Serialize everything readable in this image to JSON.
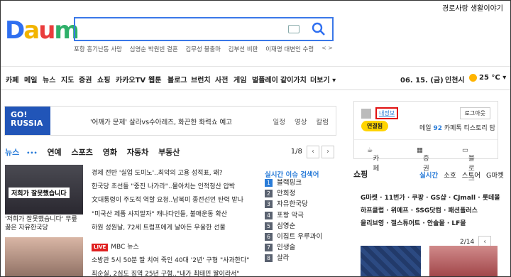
{
  "header": {
    "logo_text": "Daum",
    "stamp_text": "경로사랑 생활이야기",
    "trending": [
      "포항 흥기난동 사망",
      "심영순 박원빈 결혼",
      "김무성 불출마",
      "김부선 비판",
      "이재명 대변인",
      "이재명 대변인 수렁"
    ],
    "trending_nav": "< >"
  },
  "gnb": {
    "items": [
      "카페",
      "메일",
      "뉴스",
      "지도",
      "증권",
      "쇼핑",
      "카카오TV",
      "웹툰",
      "블로그",
      "브런치",
      "사전",
      "게임",
      "벌플레이",
      "같이가치",
      "더보기 ▾"
    ],
    "date": "06. 15. (금)",
    "city": "인천시",
    "temp": "25 °C ▾"
  },
  "banner": {
    "go_russia": "GO! RUSSIA",
    "headline": "'어깨가 문제' 살라vs수아레즈, 화끈한 화력쇼 예고",
    "tabs": [
      "일정",
      "영상",
      "칼럼"
    ]
  },
  "news": {
    "tabs": [
      "뉴스",
      "연예",
      "스포츠",
      "영화",
      "자동차",
      "부동산"
    ],
    "page": "1/8",
    "image_caption_overlay": "저희가 잘못했습니다",
    "image_caption": "'저희가 잘못했습니다' 무릎 꿇은 자유한국당",
    "headlines": [
      "경제 전반 '실업 도미노'..최악의 고용 성적표, 왜?",
      "한국당 초선들 \"중진 나가라\"..물아치는 인적청산 압박",
      "文대통령이 주도적 역할 요청..남북미 종전선언 탄력 받나",
      "\"미국산 제품 사지말자\" 캐나다인들, 불매운동 확산",
      "하원 성원날, 72세 트럼프에게 날아든 우울한 선물"
    ],
    "live_label": "LIVE",
    "live_source": "MBC 뉴스",
    "headlines2": [
      "소방관 5시 50분 딸 치여 죽인 40대 '2년' 구형 \"사과한다\"",
      "최순실, 2심도 징역 25년 구형..\"내가 최태민 딸이라서\""
    ]
  },
  "realtime": {
    "title": "실시간 이슈 검색어",
    "items": [
      {
        "rank": "1",
        "text": "블랙핑크"
      },
      {
        "rank": "2",
        "text": "안희정"
      },
      {
        "rank": "3",
        "text": "자유한국당"
      },
      {
        "rank": "4",
        "text": "포항 악극"
      },
      {
        "rank": "5",
        "text": "심영순"
      },
      {
        "rank": "6",
        "text": "이집트 우루과이"
      },
      {
        "rank": "7",
        "text": "인생술"
      },
      {
        "rank": "8",
        "text": "살라"
      }
    ]
  },
  "login": {
    "user_link": "내정보",
    "logout": "로그아웃",
    "kakao": "연결됨",
    "mail_label": "메일",
    "mail_count": "92",
    "links": [
      "카페톡",
      "티스토리",
      "탑"
    ],
    "services": [
      "카페",
      "증권",
      "블로그"
    ]
  },
  "shopping": {
    "title": "쇼핑",
    "tabs": [
      "실시간",
      "소호",
      "스토어",
      "G마켓"
    ],
    "line1": "G마켓 · 11번가 · 쿠팡 · GS샵 · CJmall · 롯데몰",
    "line2": "하프클럽 · 위메프 · SSG닷컴 · 패션플러스",
    "line3": "올리브영 · 절스튜어트 · 안솔몰 · LF몰",
    "page": "2/14"
  }
}
